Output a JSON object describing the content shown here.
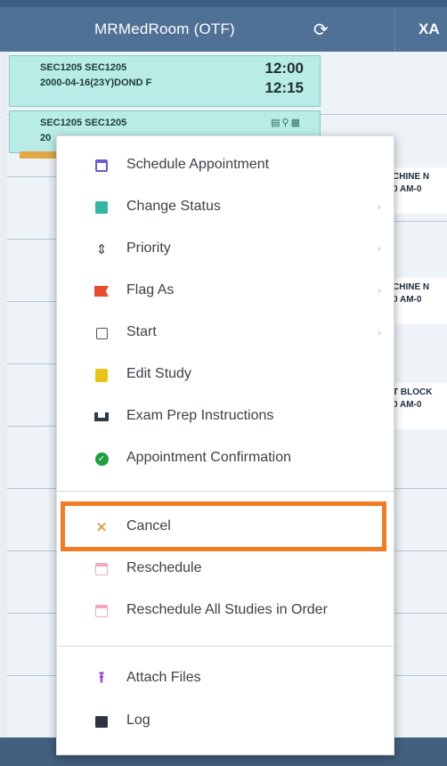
{
  "header": {
    "title": "MRMedRoom (OTF)",
    "refresh_icon": "refresh-icon",
    "right_title": "XA"
  },
  "appointments": [
    {
      "line1": "SEC1205 SEC1205",
      "line2": "2000-04-16(23Y)DOND F",
      "time_start": "12:00",
      "time_end": "12:15"
    },
    {
      "line1": "SEC1205 SEC1205",
      "line2": "20"
    }
  ],
  "right_column": [
    {
      "line1": "CHINE N",
      "line2": "0 AM-0"
    },
    {
      "line1": "CHINE N",
      "line2": "0 AM-0"
    },
    {
      "line1": "T BLOCK",
      "line2": "0 AM-0"
    }
  ],
  "context_menu": {
    "items": [
      {
        "label": "Schedule Appointment",
        "icon": "calendar-icon",
        "has_submenu": false
      },
      {
        "label": "Change Status",
        "icon": "status-square-icon",
        "has_submenu": true
      },
      {
        "label": "Priority",
        "icon": "sort-arrows-icon",
        "has_submenu": true
      },
      {
        "label": "Flag As",
        "icon": "flag-icon",
        "has_submenu": true
      },
      {
        "label": "Start",
        "icon": "checkbox-icon",
        "has_submenu": true
      },
      {
        "label": "Edit Study",
        "icon": "edit-icon",
        "has_submenu": false
      },
      {
        "label": "Exam Prep Instructions",
        "icon": "bed-icon",
        "has_submenu": false
      },
      {
        "label": "Appointment Confirmation",
        "icon": "check-circle-icon",
        "has_submenu": false
      },
      {
        "label": "Cancel",
        "icon": "close-icon",
        "has_submenu": false,
        "highlighted": true
      },
      {
        "label": "Reschedule",
        "icon": "calendar-icon",
        "has_submenu": false
      },
      {
        "label": "Reschedule All Studies in Order",
        "icon": "calendar-icon",
        "has_submenu": false
      },
      {
        "label": "Attach Files",
        "icon": "upload-icon",
        "has_submenu": false
      },
      {
        "label": "Log",
        "icon": "log-icon",
        "has_submenu": false
      }
    ],
    "submenu_arrow": "›"
  },
  "colors": {
    "header": "#4f7196",
    "card": "#b9ece6",
    "highlight": "#f07c23"
  }
}
